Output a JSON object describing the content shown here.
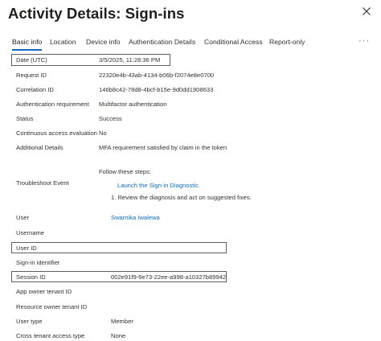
{
  "header": {
    "title": "Activity Details: Sign-ins",
    "close_icon": "close-icon"
  },
  "tabs": [
    {
      "label": "Basic info",
      "active": true
    },
    {
      "label": "Location"
    },
    {
      "label": "Device info"
    },
    {
      "label": "Authentication Details"
    },
    {
      "label": "Conditional Access"
    },
    {
      "label": "Report-only"
    }
  ],
  "more_label": "···",
  "fields": {
    "date": {
      "label": "Date (UTC)",
      "value": "3/5/2025, 11:28:36 PM"
    },
    "request_id": {
      "label": "Request ID",
      "value": "22320e4b-43ab-4134-b06b-f2074e8e0700"
    },
    "correlation_id": {
      "label": "Correlation ID",
      "value": "146b8c42-78d8-4bcf-b15e-9d0dd1908633"
    },
    "auth_requirement": {
      "label": "Authentication requirement",
      "value": "Multifactor authentication"
    },
    "status": {
      "label": "Status",
      "value": "Success"
    },
    "cae": {
      "label": "Continuous access evaluation",
      "value": "No"
    },
    "additional_details": {
      "label": "Additional Details",
      "value": "MFA requirement satisfied by claim in the token"
    },
    "troubleshoot": {
      "label": "Troubleshoot Event",
      "intro": "Follow these steps:",
      "link": "Launch the Sign-in Diagnostic.",
      "step": "1. Review the diagnosis and act on suggested fixes."
    },
    "user": {
      "label": "User",
      "value": "Swarnika Iwalewa"
    },
    "username": {
      "label": "Username",
      "value": ""
    },
    "user_id": {
      "label": "User ID",
      "value": ""
    },
    "signin_identifier": {
      "label": "Sign-in identifier",
      "value": ""
    },
    "session_id": {
      "label": "Session ID",
      "value": "002e91f9-6e73-22ee-a998-a10327b89942"
    },
    "app_owner_tenant": {
      "label": "App owner tenant ID",
      "value": ""
    },
    "resource_owner_tenant": {
      "label": "Resource owner tenant ID",
      "value": ""
    },
    "user_type": {
      "label": "User type",
      "value": "Member"
    },
    "cross_tenant": {
      "label": "Cross tenant access type",
      "value": "None"
    }
  }
}
